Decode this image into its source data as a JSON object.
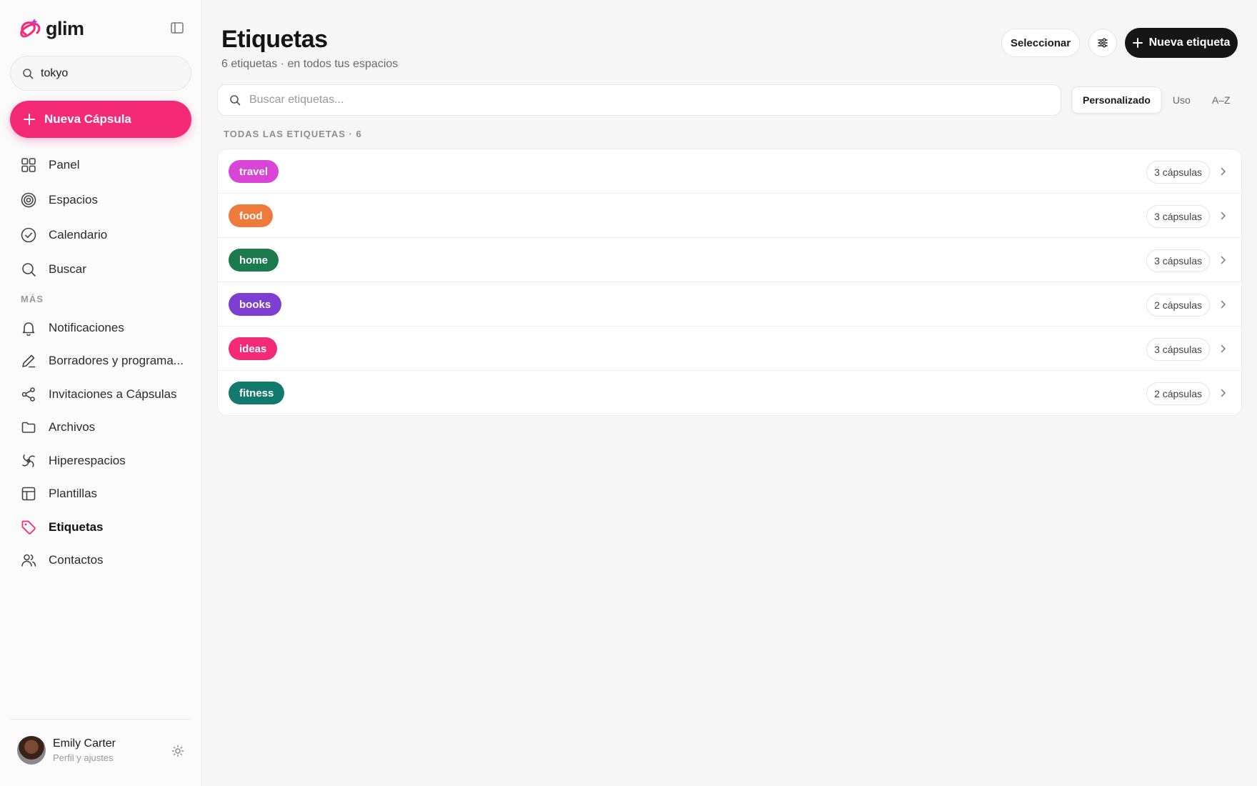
{
  "app": {
    "name": "glim"
  },
  "sidebar": {
    "search": {
      "value": "tokyo"
    },
    "new_capsule_label": "Nueva Cápsula",
    "main_items": [
      {
        "label": "Panel",
        "icon": "grid-icon"
      },
      {
        "label": "Espacios",
        "icon": "target-icon"
      },
      {
        "label": "Calendario",
        "icon": "check-circle-icon"
      },
      {
        "label": "Buscar",
        "icon": "search-icon"
      }
    ],
    "more_label": "MÁS",
    "more_items": [
      {
        "label": "Notificaciones",
        "icon": "bell-icon"
      },
      {
        "label": "Borradores y programa...",
        "icon": "pencil-icon"
      },
      {
        "label": "Invitaciones a Cápsulas",
        "icon": "share-icon"
      },
      {
        "label": "Archivos",
        "icon": "folder-icon"
      },
      {
        "label": "Hiperespacios",
        "icon": "swirl-icon"
      },
      {
        "label": "Plantillas",
        "icon": "layout-icon"
      },
      {
        "label": "Etiquetas",
        "icon": "tag-icon",
        "active": true
      },
      {
        "label": "Contactos",
        "icon": "users-icon"
      }
    ],
    "profile": {
      "name": "Emily Carter",
      "subtitle": "Perfil y ajustes"
    }
  },
  "header": {
    "title": "Etiquetas",
    "subtitle": "6 etiquetas · en todos tus espacios",
    "select_label": "Seleccionar",
    "new_tag_label": "Nueva etiqueta"
  },
  "tag_search": {
    "placeholder": "Buscar etiquetas..."
  },
  "sort": {
    "options": [
      "Personalizado",
      "Uso",
      "A–Z"
    ],
    "selected": "Personalizado"
  },
  "list": {
    "label": "TODAS LAS ETIQUETAS · 6",
    "tags": [
      {
        "name": "travel",
        "count": "3 cápsulas",
        "color": "#d946d6"
      },
      {
        "name": "food",
        "count": "3 cápsulas",
        "color": "#ee7a3c"
      },
      {
        "name": "home",
        "count": "3 cápsulas",
        "color": "#1b7a4e"
      },
      {
        "name": "books",
        "count": "2 cápsulas",
        "color": "#7c3fcf"
      },
      {
        "name": "ideas",
        "count": "3 cápsulas",
        "color": "#f42a76"
      },
      {
        "name": "fitness",
        "count": "2 cápsulas",
        "color": "#127a6c"
      }
    ]
  },
  "colors": {
    "accent": "#f42a76",
    "primary_dark": "#161616"
  }
}
